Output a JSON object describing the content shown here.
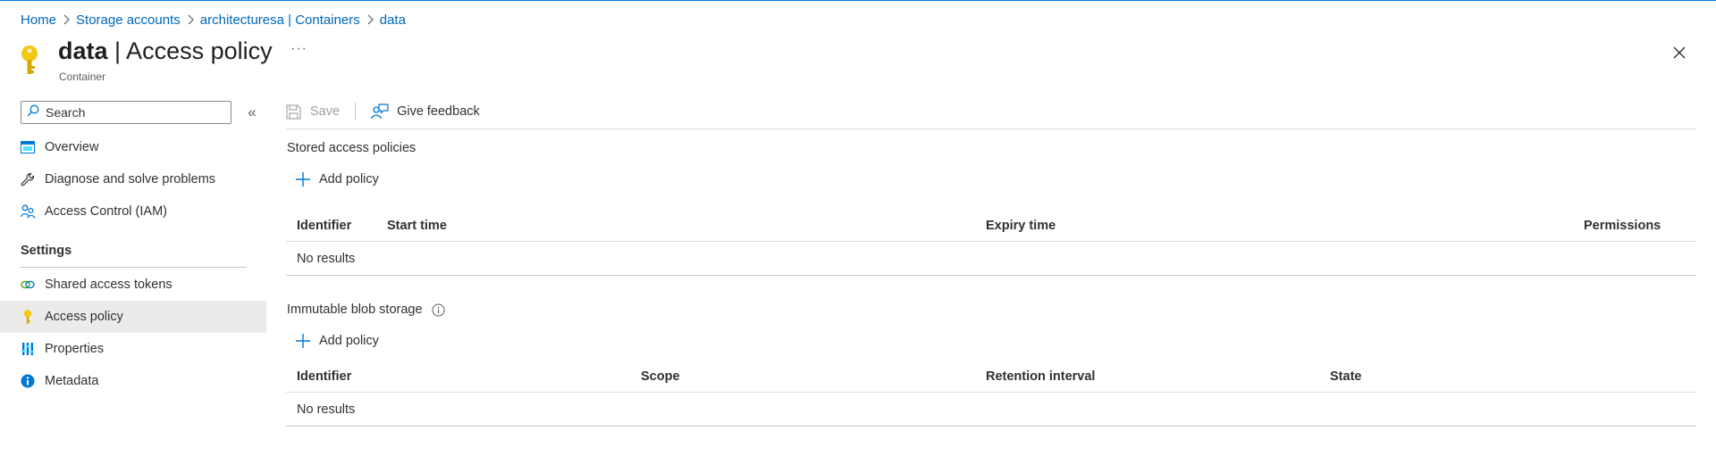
{
  "breadcrumb": [
    {
      "label": "Home"
    },
    {
      "label": "Storage accounts"
    },
    {
      "label": "architecturesa | Containers"
    },
    {
      "label": "data"
    }
  ],
  "header": {
    "title_bold": "data",
    "title_rest": " | Access policy",
    "subtitle": "Container",
    "more": "···"
  },
  "sidebar": {
    "search_placeholder": "Search",
    "collapse": "«",
    "items": [
      {
        "label": "Overview",
        "icon": "overview-icon"
      },
      {
        "label": "Diagnose and solve problems",
        "icon": "wrench-icon"
      },
      {
        "label": "Access Control (IAM)",
        "icon": "people-icon"
      }
    ],
    "section_settings": "Settings",
    "settings_items": [
      {
        "label": "Shared access tokens",
        "icon": "link-icon"
      },
      {
        "label": "Access policy",
        "icon": "key-icon",
        "selected": true
      },
      {
        "label": "Properties",
        "icon": "properties-icon"
      },
      {
        "label": "Metadata",
        "icon": "info-icon"
      }
    ]
  },
  "toolbar": {
    "save_label": "Save",
    "feedback_label": "Give feedback"
  },
  "stored_policies": {
    "title": "Stored access policies",
    "add_label": "Add policy",
    "columns": [
      "Identifier",
      "Start time",
      "Expiry time",
      "Permissions"
    ],
    "empty_text": "No results"
  },
  "immutable": {
    "title": "Immutable blob storage",
    "add_label": "Add policy",
    "columns": [
      "Identifier",
      "Scope",
      "Retention interval",
      "State"
    ],
    "empty_text": "No results"
  },
  "colors": {
    "accent": "#0078d4",
    "link": "#0067b8",
    "key_yellow": "#f2c811",
    "selected_bg": "#edebe9"
  }
}
